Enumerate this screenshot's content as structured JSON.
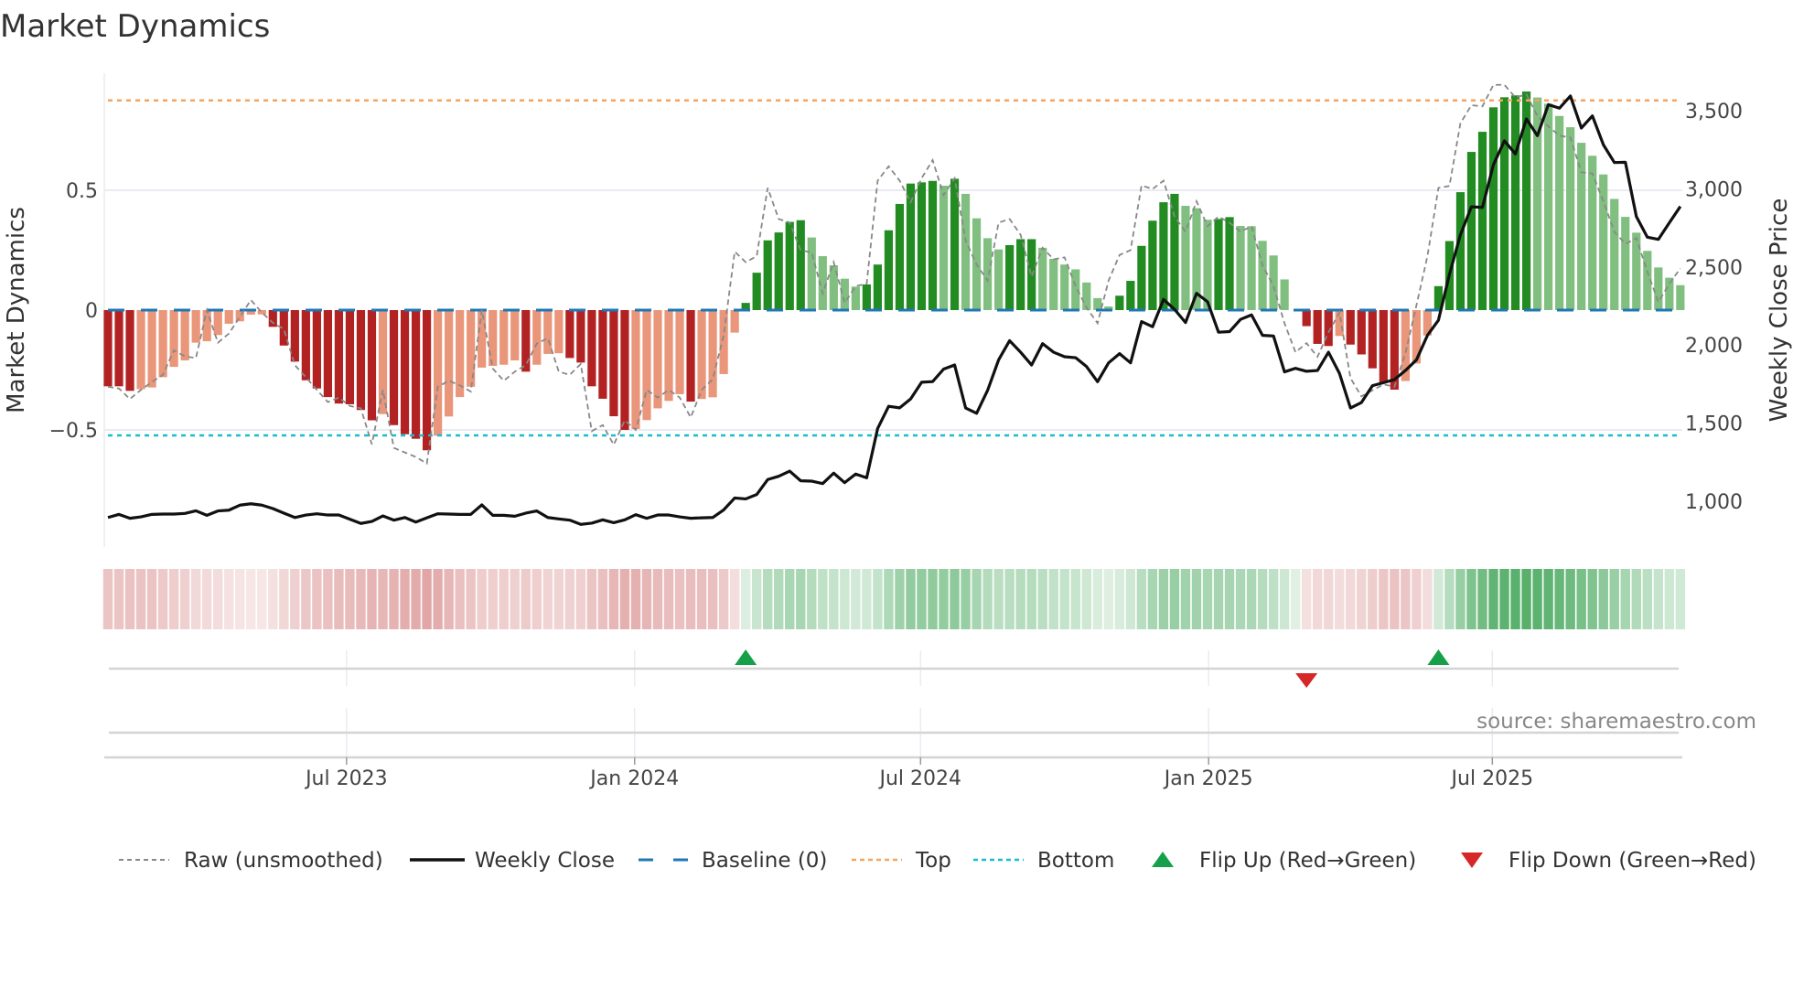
{
  "chart_data": {
    "type": "bar",
    "title": "Market Dynamics",
    "ylabel_left": "Market Dynamics",
    "ylabel_right": "Weekly Close Price",
    "left_axis": {
      "range": [
        -0.9,
        0.98
      ],
      "ticks": [
        {
          "value": 0.5,
          "label": "0.5"
        },
        {
          "value": 0,
          "label": "0"
        },
        {
          "value": -0.5,
          "label": "−0.5"
        }
      ]
    },
    "right_axis": {
      "ticks": [
        {
          "value": 3500,
          "label": "3,500"
        },
        {
          "value": 3000,
          "label": "3,000"
        },
        {
          "value": 2500,
          "label": "2,500"
        },
        {
          "value": 2000,
          "label": "2,000"
        },
        {
          "value": 1500,
          "label": "1,500"
        },
        {
          "value": 1000,
          "label": "1,000"
        }
      ]
    },
    "x_ticks": [
      {
        "label": "Jul 2023",
        "week_index": 21.7
      },
      {
        "label": "Jan 2024",
        "week_index": 47.9
      },
      {
        "label": "Jul 2024",
        "week_index": 73.9
      },
      {
        "label": "Jan 2025",
        "week_index": 100.1
      },
      {
        "label": "Jul 2025",
        "week_index": 125.9
      }
    ],
    "thresholds": {
      "baseline": 0,
      "top": 0.875,
      "bottom": -0.523
    },
    "grid": true,
    "legend_position": "bottom",
    "series": [
      {
        "name": "Market Dynamics (smoothed)",
        "type": "bar",
        "values": [
          -0.318,
          -0.318,
          -0.337,
          -0.33,
          -0.323,
          -0.28,
          -0.237,
          -0.21,
          -0.136,
          -0.13,
          -0.104,
          -0.057,
          -0.047,
          -0.019,
          -0.018,
          -0.07,
          -0.148,
          -0.215,
          -0.293,
          -0.327,
          -0.363,
          -0.39,
          -0.393,
          -0.417,
          -0.46,
          -0.434,
          -0.48,
          -0.518,
          -0.537,
          -0.585,
          -0.524,
          -0.444,
          -0.363,
          -0.32,
          -0.24,
          -0.233,
          -0.228,
          -0.21,
          -0.257,
          -0.228,
          -0.183,
          -0.18,
          -0.2,
          -0.219,
          -0.318,
          -0.37,
          -0.443,
          -0.5,
          -0.496,
          -0.459,
          -0.41,
          -0.379,
          -0.351,
          -0.382,
          -0.371,
          -0.364,
          -0.267,
          -0.094,
          0.03,
          0.156,
          0.291,
          0.324,
          0.368,
          0.375,
          0.303,
          0.225,
          0.187,
          0.131,
          0.098,
          0.107,
          0.19,
          0.333,
          0.443,
          0.528,
          0.533,
          0.539,
          0.519,
          0.548,
          0.485,
          0.383,
          0.3,
          0.253,
          0.271,
          0.296,
          0.296,
          0.26,
          0.214,
          0.19,
          0.17,
          0.115,
          0.05,
          0.015,
          0.06,
          0.122,
          0.268,
          0.373,
          0.45,
          0.485,
          0.435,
          0.425,
          0.377,
          0.38,
          0.388,
          0.351,
          0.35,
          0.289,
          0.228,
          0.128,
          0.0,
          -0.067,
          -0.141,
          -0.15,
          -0.108,
          -0.144,
          -0.185,
          -0.243,
          -0.303,
          -0.332,
          -0.296,
          -0.223,
          -0.106,
          0.1,
          0.288,
          0.492,
          0.66,
          0.744,
          0.846,
          0.888,
          0.896,
          0.912,
          0.887,
          0.861,
          0.81,
          0.763,
          0.698,
          0.644,
          0.566,
          0.464,
          0.389,
          0.323,
          0.247,
          0.178,
          0.135,
          0.104
        ]
      },
      {
        "name": "Raw (unsmoothed)",
        "type": "line",
        "values": [
          -0.32,
          -0.327,
          -0.371,
          -0.333,
          -0.3,
          -0.27,
          -0.168,
          -0.193,
          -0.2,
          0,
          -0.136,
          -0.098,
          -0.028,
          0.042,
          -0.01,
          -0.053,
          -0.079,
          -0.23,
          -0.28,
          -0.333,
          -0.384,
          -0.365,
          -0.4,
          -0.41,
          -0.56,
          -0.333,
          -0.575,
          -0.594,
          -0.613,
          -0.64,
          -0.32,
          -0.295,
          -0.314,
          -0.34,
          0,
          -0.244,
          -0.295,
          -0.257,
          -0.23,
          -0.14,
          -0.117,
          -0.257,
          -0.27,
          -0.225,
          -0.505,
          -0.48,
          -0.562,
          -0.46,
          -0.5,
          -0.333,
          -0.365,
          -0.333,
          -0.365,
          -0.448,
          -0.333,
          -0.289,
          -0.104,
          0.244,
          0.2,
          0.225,
          0.51,
          0.38,
          0.365,
          0.25,
          0.24,
          0.07,
          0.2,
          0.03,
          0.1,
          0.11,
          0.54,
          0.6,
          0.54,
          0.45,
          0.55,
          0.626,
          0.48,
          0.55,
          0.29,
          0.19,
          0.123,
          0.365,
          0.38,
          0.314,
          0.14,
          0.26,
          0.212,
          0.22,
          0.1,
          0.01,
          -0.055,
          0.123,
          0.23,
          0.25,
          0.52,
          0.505,
          0.54,
          0.39,
          0.327,
          0.454,
          0.35,
          0.39,
          0.365,
          0.327,
          0.35,
          0.187,
          0.1,
          -0.055,
          -0.176,
          -0.138,
          -0.195,
          -0.093,
          -0.01,
          -0.284,
          -0.36,
          -0.335,
          -0.31,
          -0.32,
          -0.18,
          0.02,
          0.225,
          0.51,
          0.518,
          0.78,
          0.855,
          0.85,
          0.94,
          0.94,
          0.887,
          0.9,
          0.81,
          0.766,
          0.728,
          0.72,
          0.575,
          0.57,
          0.454,
          0.327,
          0.276,
          0.3,
          0.16,
          0.034,
          0.11,
          0.174
        ]
      },
      {
        "name": "Weekly Close",
        "type": "line",
        "axis": "right",
        "values": [
          896,
          916,
          891,
          900,
          916,
          918,
          918,
          922,
          939,
          910,
          938,
          943,
          975,
          984,
          975,
          953,
          924,
          896,
          912,
          920,
          912,
          912,
          885,
          858,
          871,
          906,
          879,
          896,
          867,
          894,
          920,
          918,
          916,
          916,
          977,
          910,
          910,
          904,
          924,
          938,
          896,
          887,
          879,
          852,
          860,
          881,
          863,
          881,
          914,
          891,
          912,
          912,
          900,
          891,
          894,
          896,
          945,
          1021,
          1015,
          1043,
          1139,
          1160,
          1193,
          1131,
          1129,
          1113,
          1180,
          1119,
          1174,
          1150,
          1466,
          1608,
          1598,
          1655,
          1762,
          1766,
          1846,
          1872,
          1597,
          1563,
          1710,
          1905,
          2028,
          1954,
          1872,
          2009,
          1954,
          1925,
          1919,
          1862,
          1765,
          1886,
          1945,
          1886,
          2150,
          2117,
          2292,
          2228,
          2144,
          2331,
          2277,
          2082,
          2086,
          2164,
          2193,
          2062,
          2058,
          1828,
          1851,
          1832,
          1837,
          1954,
          1818,
          1597,
          1632,
          1740,
          1759,
          1779,
          1837,
          1905,
          2062,
          2159,
          2452,
          2706,
          2885,
          2881,
          3154,
          3307,
          3223,
          3447,
          3340,
          3539,
          3516,
          3594,
          3389,
          3467,
          3282,
          3168,
          3170,
          2822,
          2690,
          2676,
          2783,
          2887
        ]
      }
    ],
    "flips": [
      {
        "week_index": 58,
        "direction": "up"
      },
      {
        "week_index": 109,
        "direction": "down"
      },
      {
        "week_index": 121,
        "direction": "up"
      }
    ],
    "legend": [
      {
        "key": "raw",
        "label": "Raw (unsmoothed)"
      },
      {
        "key": "close",
        "label": "Weekly Close"
      },
      {
        "key": "baseline",
        "label": "Baseline (0)"
      },
      {
        "key": "top",
        "label": "Top"
      },
      {
        "key": "bottom",
        "label": "Bottom"
      },
      {
        "key": "flip_up",
        "label": "Flip Up (Red→Green)"
      },
      {
        "key": "flip_down",
        "label": "Flip Down (Green→Red)"
      }
    ],
    "source": "source: sharemaestro.com"
  },
  "colors": {
    "dark_red": "#b22222",
    "light_red": "#e9967a",
    "dark_green": "#228b22",
    "light_green": "#80bf80",
    "baseline": "#1f77b4",
    "top": "#f4a460",
    "bottom": "#17becf",
    "raw": "#888888",
    "close": "#111111",
    "flip_up": "#16a04a",
    "flip_down": "#d62728"
  }
}
